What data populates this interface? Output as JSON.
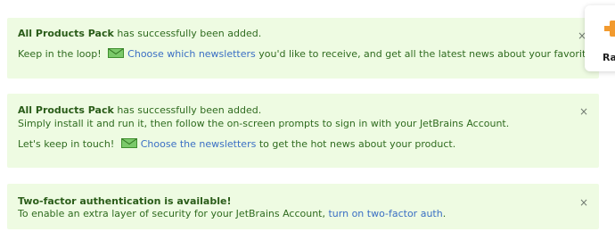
{
  "notices": [
    {
      "product": "All Products Pack",
      "added_text": " has successfully been added.",
      "newsletter_prefix": "Keep in the loop!",
      "newsletter_link": "Choose which newsletters",
      "newsletter_suffix": " you'd like to receive, and get all the latest news about your favorite products.",
      "close": "×"
    },
    {
      "product": "All Products Pack",
      "added_text": " has successfully been added.",
      "install_text": "Simply install it and run it, then follow the on-screen prompts to sign in with your JetBrains Account.",
      "newsletter_prefix": "Let's keep in touch!",
      "newsletter_link": "Choose the newsletters",
      "newsletter_suffix": " to get the hot news about your product.",
      "close": "×"
    },
    {
      "title": "Two-factor authentication is available!",
      "body_prefix": "To enable an extra layer of security for your JetBrains Account, ",
      "link": "turn on two-factor auth",
      "body_suffix": ".",
      "close": "×"
    }
  ],
  "side_card": {
    "label": "Ra",
    "icon": "jetbrains-product-icon"
  },
  "colors": {
    "notice_bg": "#eefbe2",
    "text": "#2f6b1f",
    "link": "#3a6fc4",
    "icon_green": "#4caf3a",
    "product_icon": "#f29a2e"
  },
  "icons": {
    "newsletter": "envelope-icon",
    "close": "close-icon"
  }
}
